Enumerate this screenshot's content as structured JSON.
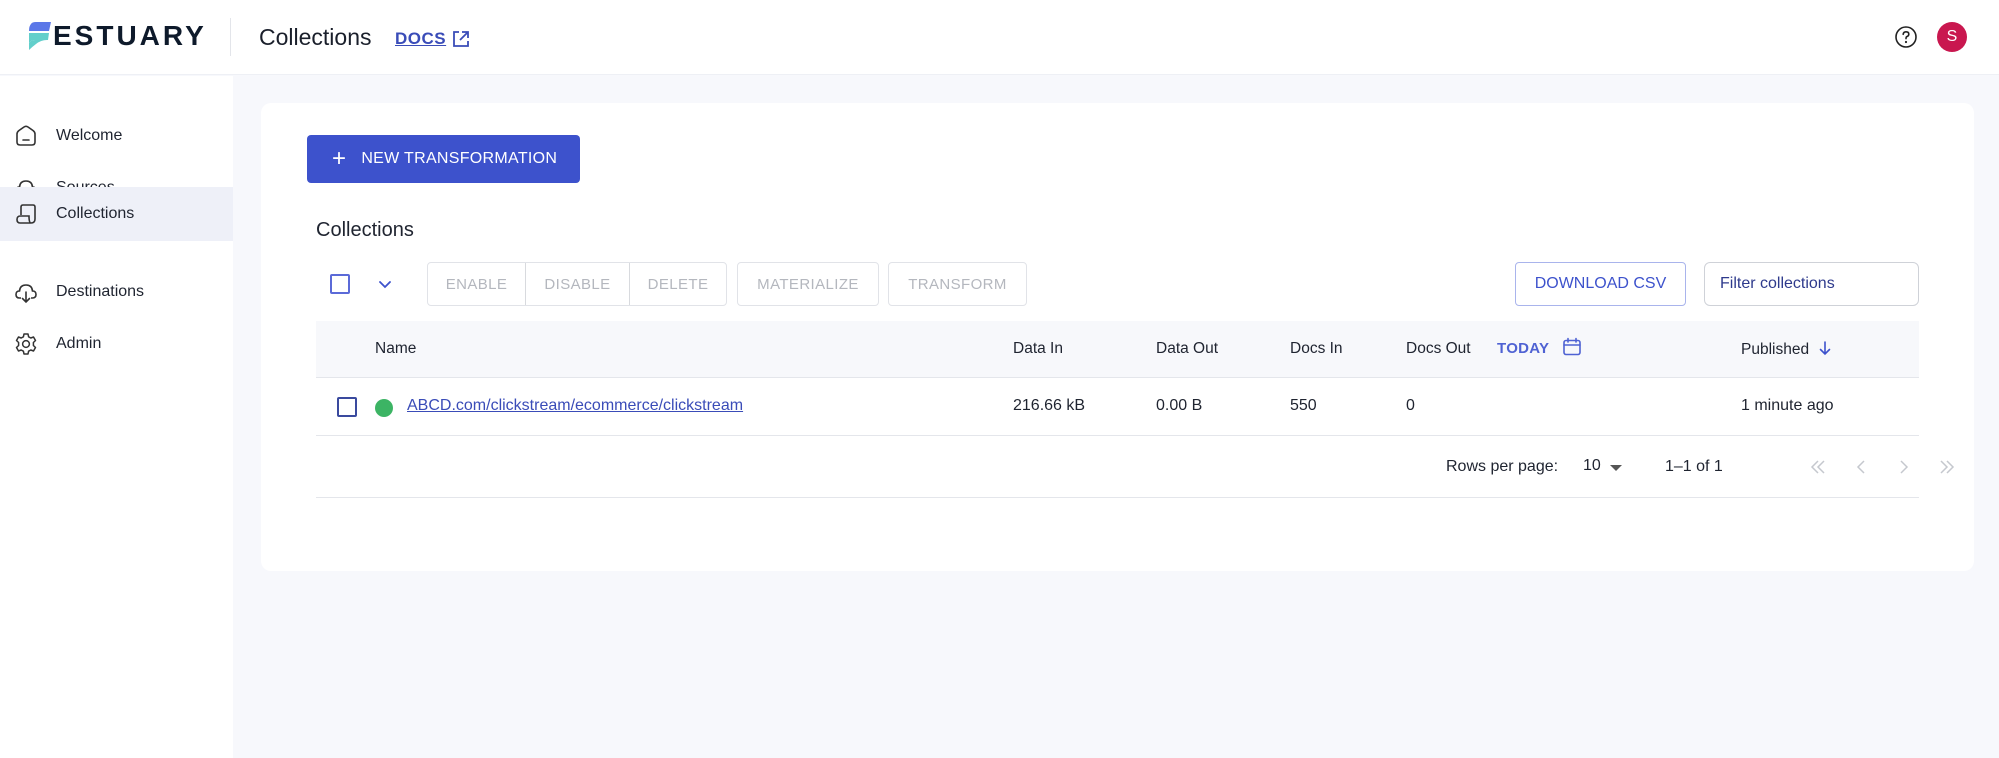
{
  "header": {
    "brand": "ESTUARY",
    "page_title": "Collections",
    "docs_label": "DOCS",
    "avatar_initial": "S"
  },
  "sidebar": {
    "items": [
      {
        "label": "Welcome",
        "icon": "home-icon",
        "active": false
      },
      {
        "label": "Sources",
        "icon": "cloud-upload-icon",
        "active": false
      },
      {
        "label": "Collections",
        "icon": "collections-icon",
        "active": true
      },
      {
        "label": "Destinations",
        "icon": "cloud-download-icon",
        "active": false
      },
      {
        "label": "Admin",
        "icon": "gear-icon",
        "active": false
      }
    ]
  },
  "main": {
    "new_button_label": "NEW TRANSFORMATION",
    "section_title": "Collections",
    "toolbar": {
      "enable_label": "ENABLE",
      "disable_label": "DISABLE",
      "delete_label": "DELETE",
      "materialize_label": "MATERIALIZE",
      "transform_label": "TRANSFORM",
      "download_label": "DOWNLOAD CSV",
      "filter_placeholder": "Filter collections"
    },
    "table": {
      "columns": {
        "name": "Name",
        "data_in": "Data In",
        "data_out": "Data Out",
        "docs_in": "Docs In",
        "docs_out": "Docs Out",
        "range": "TODAY",
        "published": "Published"
      },
      "rows": [
        {
          "status": "active",
          "name": "ABCD.com/clickstream/ecommerce/clickstream",
          "data_in": "216.66 kB",
          "data_out": "0.00 B",
          "docs_in": "550",
          "docs_out": "0",
          "published": "1 minute ago"
        }
      ]
    },
    "pagination": {
      "rows_per_page_label": "Rows per page:",
      "rows_per_page": "10",
      "range": "1–1 of 1"
    }
  },
  "colors": {
    "primary": "#3d52cc",
    "status_active": "#3cb464",
    "avatar": "#c9174f"
  }
}
